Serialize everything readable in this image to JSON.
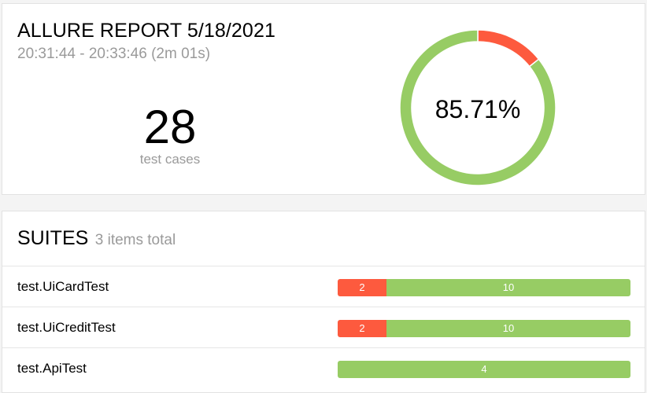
{
  "summary": {
    "title": "ALLURE REPORT 5/18/2021",
    "time_range": "20:31:44 - 20:33:46 (2m 01s)",
    "test_count": "28",
    "test_count_label": "test cases",
    "success_rate": "85.71%",
    "chart_data": {
      "type": "pie",
      "categories": [
        "failed",
        "passed"
      ],
      "values": [
        4,
        24
      ],
      "colors": [
        "#fd5a3e",
        "#97cc64"
      ]
    }
  },
  "suites": {
    "title": "SUITES",
    "total_label": "3 items total",
    "items": [
      {
        "name": "test.UiCardTest",
        "failed": 2,
        "passed": 10,
        "failed_label": "2",
        "passed_label": "10"
      },
      {
        "name": "test.UiCreditTest",
        "failed": 2,
        "passed": 10,
        "failed_label": "2",
        "passed_label": "10"
      },
      {
        "name": "test.ApiTest",
        "failed": 0,
        "passed": 4,
        "failed_label": "",
        "passed_label": "4"
      }
    ]
  },
  "colors": {
    "failed": "#fd5a3e",
    "passed": "#97cc64",
    "muted_text": "#9a9a9a"
  }
}
